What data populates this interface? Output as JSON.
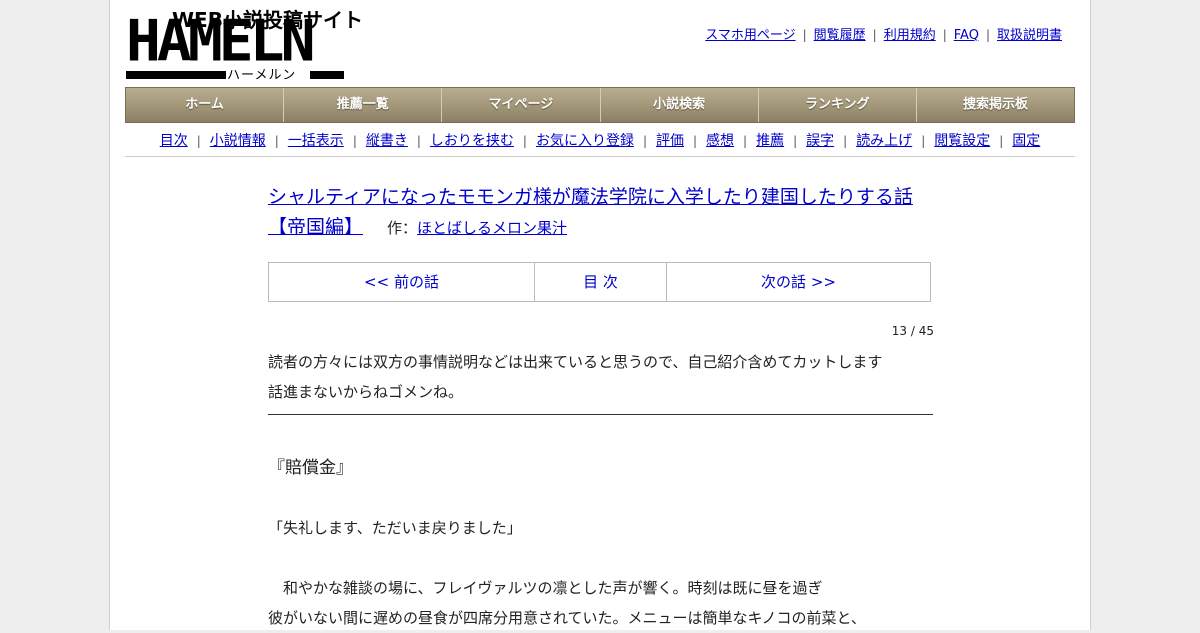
{
  "logo": {
    "tagline": "WEB小説投稿サイト",
    "wordmark": "HAMELN",
    "kana": "ハーメルン"
  },
  "top_links": [
    "スマホ用ページ",
    "閲覧履歴",
    "利用規約",
    "FAQ",
    "取扱説明書"
  ],
  "main_nav": [
    "ホーム",
    "推薦一覧",
    "マイページ",
    "小説検索",
    "ランキング",
    "捜索掲示板"
  ],
  "sub_nav": [
    "目次",
    "小説情報",
    "一括表示",
    "縦書き",
    "しおりを挟む",
    "お気に入り登録",
    "評価",
    "感想",
    "推薦",
    "誤字",
    "読み上げ",
    "閲覧設定",
    "固定"
  ],
  "story": {
    "title": "シャルティアになったモモンガ様が魔法学院に入学したり建国したりする話【帝国編】",
    "author_label": "作：",
    "author": "ほとばしるメロン果汁"
  },
  "chapter_nav": {
    "prev": "<< 前の話",
    "toc": "目 次",
    "next": "次の話 >>"
  },
  "counter": "13 / 45",
  "preface": [
    "読者の方々には双方の事情説明などは出来ていると思うので、自己紹介含めてカットします",
    "話進まないからねゴメンね。"
  ],
  "body": {
    "heading": "『賠償金』",
    "lines": [
      "「失礼します、ただいま戻りました」",
      "　和やかな雑談の場に、フレイヴァルツの凛とした声が響く。時刻は既に昼を過ぎ",
      "彼がいない間に遅めの昼食が四席分用意されていた。メニューは簡単なキノコの前菜と、"
    ]
  },
  "colors": {
    "link": "#0000cc",
    "nav_bg": "#a3987a",
    "page_bg": "#eeeeee"
  }
}
